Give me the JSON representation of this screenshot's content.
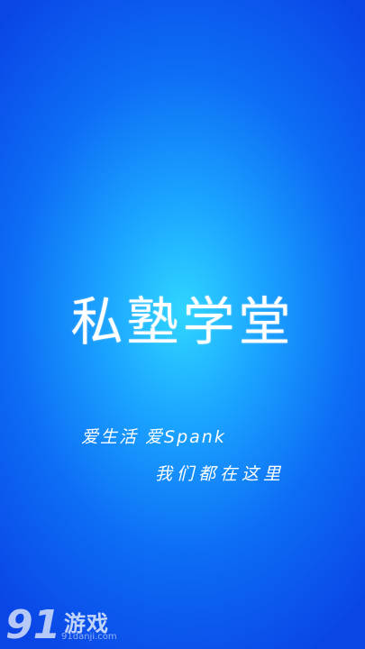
{
  "splash": {
    "app_title": "私塾学堂",
    "slogan_line1": "爱生活 爱Spank",
    "slogan_line2": "我们都在这里"
  },
  "watermark": {
    "logo_text": "91",
    "brand_text": "游戏",
    "url": "91danji.com"
  },
  "colors": {
    "background_center": "#2fd6ff",
    "background_edge": "#0a45e6",
    "text": "#ffffff"
  }
}
